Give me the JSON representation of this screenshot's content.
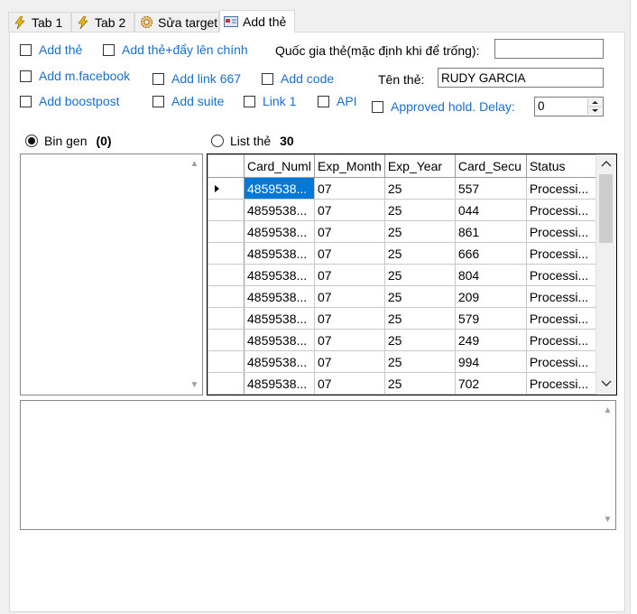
{
  "tabs": [
    {
      "label": "Tab 1",
      "icon": "lightning-icon"
    },
    {
      "label": "Tab 2",
      "icon": "lightning-icon"
    },
    {
      "label": "Sửa target",
      "icon": "gear-icon"
    },
    {
      "label": "Add thẻ",
      "icon": "card-icon"
    }
  ],
  "options": {
    "add_the": "Add thẻ",
    "add_the_day": "Add thẻ+đẩy lên chính",
    "add_mfacebook": "Add m.facebook",
    "add_link_667": "Add link 667",
    "add_code": "Add code",
    "add_boostpost": "Add boostpost",
    "add_suite": "Add suite",
    "link_1": "Link 1",
    "api": "API",
    "approved_hold_delay": "Approved hold. Delay:"
  },
  "fields": {
    "country_label": "Quốc gia thẻ(mặc định khi để trống):",
    "country_value": "",
    "name_label": "Tên thẻ:",
    "name_value": "RUDY GARCIA",
    "delay_value": "0"
  },
  "bin_gen": {
    "label": "Bin gen",
    "count": "(0)",
    "selected": true
  },
  "list_the": {
    "label": "List thẻ",
    "count": "30",
    "selected": false
  },
  "grid": {
    "columns": [
      "Card_Numl",
      "Exp_Month",
      "Exp_Year",
      "Card_Secu",
      "Status"
    ],
    "rows": [
      [
        "4859538...",
        "07",
        "25",
        "557",
        "Processi..."
      ],
      [
        "4859538...",
        "07",
        "25",
        "044",
        "Processi..."
      ],
      [
        "4859538...",
        "07",
        "25",
        "861",
        "Processi..."
      ],
      [
        "4859538...",
        "07",
        "25",
        "666",
        "Processi..."
      ],
      [
        "4859538...",
        "07",
        "25",
        "804",
        "Processi..."
      ],
      [
        "4859538...",
        "07",
        "25",
        "209",
        "Processi..."
      ],
      [
        "4859538...",
        "07",
        "25",
        "579",
        "Processi..."
      ],
      [
        "4859538...",
        "07",
        "25",
        "249",
        "Processi..."
      ],
      [
        "4859538...",
        "07",
        "25",
        "994",
        "Processi..."
      ],
      [
        "4859538...",
        "07",
        "25",
        "702",
        "Processi..."
      ]
    ]
  },
  "colors": {
    "link_blue": "#1a6fc9",
    "selection": "#0078d7"
  }
}
